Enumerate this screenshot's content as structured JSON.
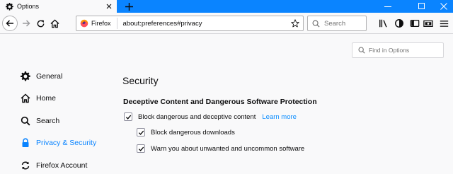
{
  "tab": {
    "title": "Options",
    "icon": "gear-icon"
  },
  "window": {
    "minimize_icon": "minimize-icon",
    "maximize_icon": "maximize-icon",
    "close_icon": "close-icon"
  },
  "nav": {
    "identity_label": "Firefox",
    "url": "about:preferences#privacy",
    "search_placeholder": "Search"
  },
  "find": {
    "placeholder": "Find in Options"
  },
  "sidebar": {
    "items": [
      {
        "label": "General",
        "icon": "gear-icon",
        "selected": false
      },
      {
        "label": "Home",
        "icon": "home-icon",
        "selected": false
      },
      {
        "label": "Search",
        "icon": "search-icon",
        "selected": false
      },
      {
        "label": "Privacy & Security",
        "icon": "lock-icon",
        "selected": true
      },
      {
        "label": "Firefox Account",
        "icon": "sync-icon",
        "selected": false
      }
    ]
  },
  "main": {
    "heading": "Security",
    "subheading": "Deceptive Content and Dangerous Software Protection",
    "options": [
      {
        "label": "Block dangerous and deceptive content",
        "checked": true,
        "link": "Learn more"
      },
      {
        "label": "Block dangerous downloads",
        "checked": true
      },
      {
        "label": "Warn you about unwanted and uncommon software",
        "checked": true
      }
    ]
  },
  "colors": {
    "accent": "#0a84ff",
    "tabstrip": "#0a84ff",
    "background": "#f9f9fa"
  }
}
